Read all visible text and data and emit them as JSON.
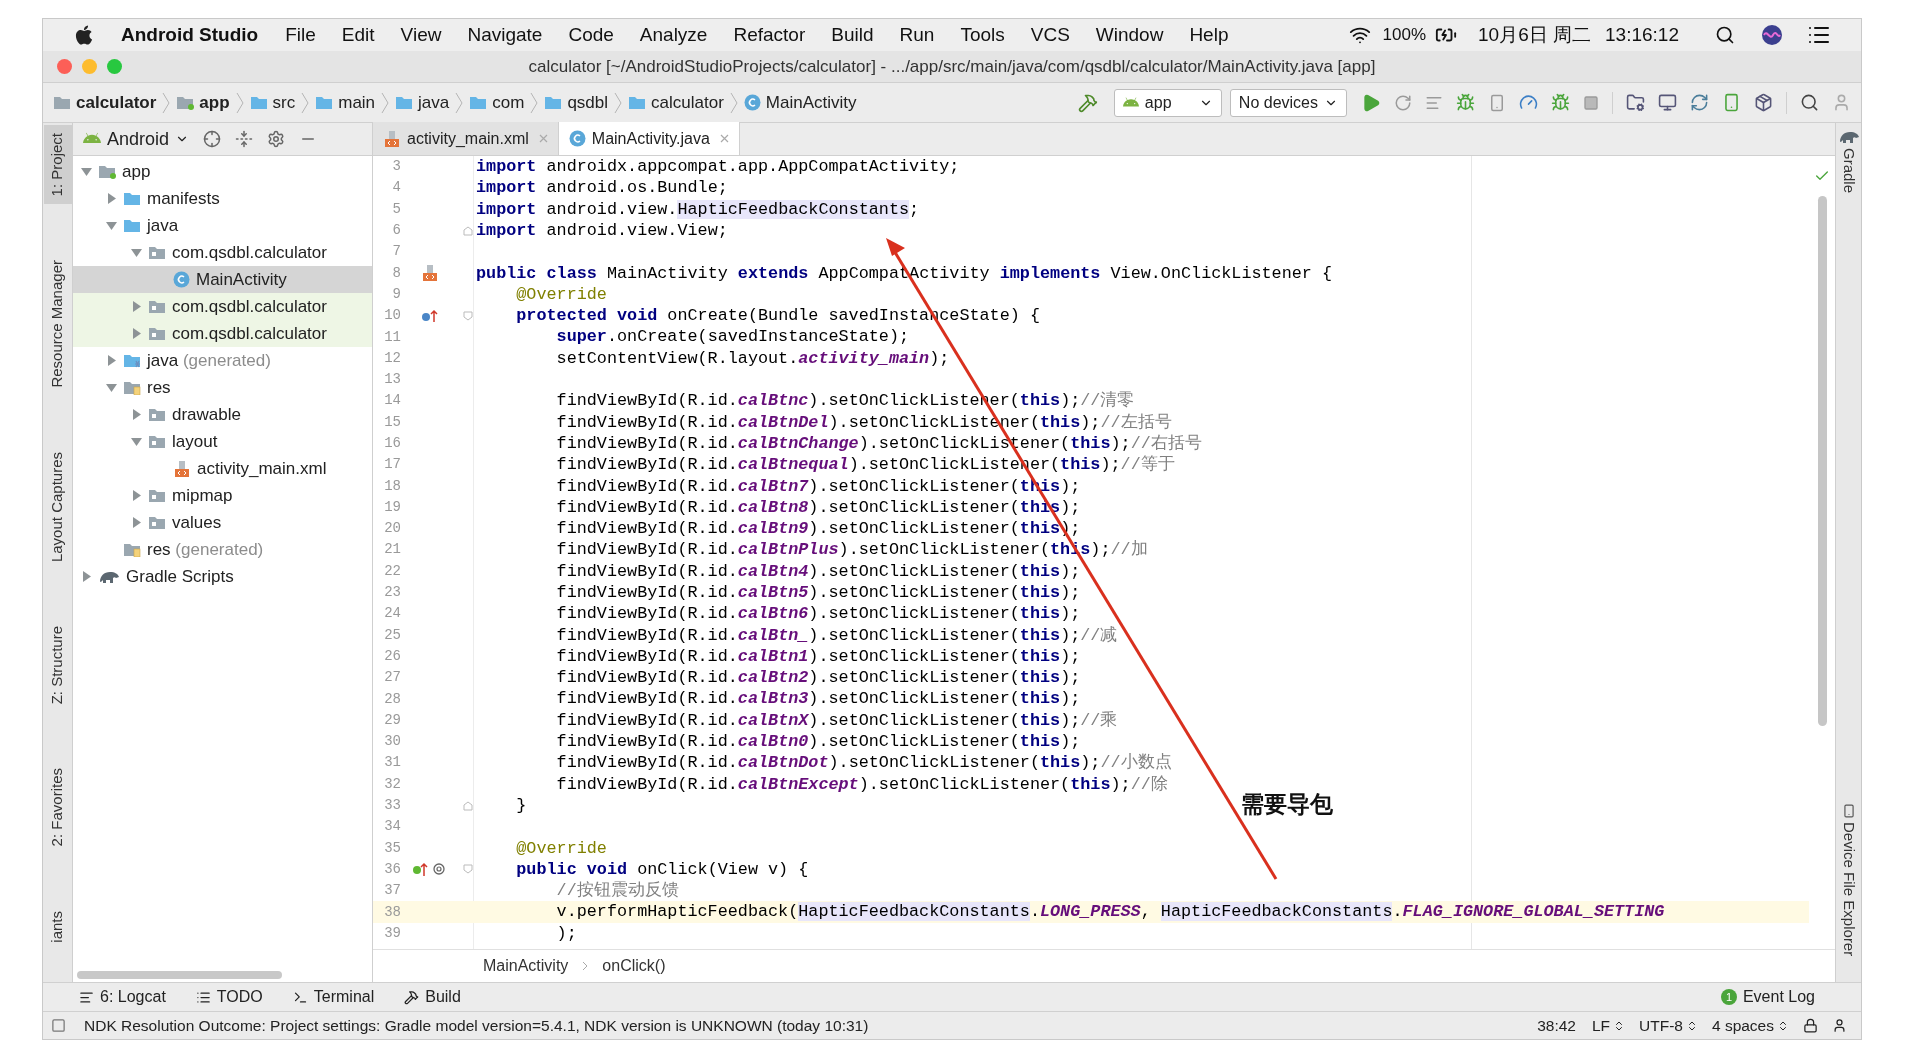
{
  "menu_bar": {
    "app_name": "Android Studio",
    "menus": [
      "File",
      "Edit",
      "View",
      "Navigate",
      "Code",
      "Analyze",
      "Refactor",
      "Build",
      "Run",
      "Tools",
      "VCS",
      "Window",
      "Help"
    ],
    "battery": "100%",
    "date": "10月6日 周二",
    "time": "13:16:12"
  },
  "window": {
    "title": "calculator [~/AndroidStudioProjects/calculator] - .../app/src/main/java/com/qsdbl/calculator/MainActivity.java [app]"
  },
  "navigation_bar": {
    "crumbs": [
      {
        "label": "calculator",
        "kind": "project"
      },
      {
        "label": "app",
        "kind": "module"
      },
      {
        "label": "src",
        "kind": "folder"
      },
      {
        "label": "main",
        "kind": "folder"
      },
      {
        "label": "java",
        "kind": "source"
      },
      {
        "label": "com",
        "kind": "folder"
      },
      {
        "label": "qsdbl",
        "kind": "folder"
      },
      {
        "label": "calculator",
        "kind": "folder"
      },
      {
        "label": "MainActivity",
        "kind": "class"
      }
    ],
    "run_configuration": "app",
    "device": "No devices"
  },
  "left_tool_strip": [
    {
      "label": "1: Project",
      "selected": true
    },
    {
      "label": "Resource Manager",
      "selected": false
    },
    {
      "label": "Layout Captures",
      "selected": false
    },
    {
      "label": "Z: Structure",
      "selected": false
    },
    {
      "label": "2: Favorites",
      "selected": false
    },
    {
      "label": "iants",
      "selected": false
    }
  ],
  "project_panel": {
    "view": "Android",
    "tree": [
      {
        "label": "app",
        "kind": "module",
        "expanded": true,
        "selected": false,
        "children": [
          {
            "label": "manifests",
            "kind": "folder",
            "expanded": false,
            "selected": false
          },
          {
            "label": "java",
            "kind": "folder",
            "expanded": true,
            "selected": false,
            "children": [
              {
                "label": "com.qsdbl.calculator",
                "kind": "package",
                "expanded": true,
                "selected": false,
                "children": [
                  {
                    "label": "MainActivity",
                    "kind": "class",
                    "selected": true
                  }
                ]
              },
              {
                "label": "com.qsdbl.calculator",
                "kind": "test-package",
                "expanded": false,
                "selected": false
              },
              {
                "label": "com.qsdbl.calculator",
                "kind": "test-package",
                "expanded": false,
                "selected": false
              }
            ]
          },
          {
            "label": "java",
            "note": "(generated)",
            "kind": "generated-folder",
            "expanded": false,
            "selected": false
          },
          {
            "label": "res",
            "kind": "res-folder",
            "expanded": true,
            "selected": false,
            "children": [
              {
                "label": "drawable",
                "kind": "package",
                "expanded": false,
                "selected": false
              },
              {
                "label": "layout",
                "kind": "package",
                "expanded": true,
                "selected": false,
                "children": [
                  {
                    "label": "activity_main.xml",
                    "kind": "xml",
                    "selected": false
                  }
                ]
              },
              {
                "label": "mipmap",
                "kind": "package",
                "expanded": false,
                "selected": false
              },
              {
                "label": "values",
                "kind": "package",
                "expanded": false,
                "selected": false
              }
            ]
          },
          {
            "label": "res",
            "note": "(generated)",
            "kind": "res-folder",
            "selected": false
          }
        ]
      },
      {
        "label": "Gradle Scripts",
        "kind": "gradle",
        "expanded": false,
        "selected": false
      }
    ]
  },
  "editor_tabs": [
    {
      "label": "activity_main.xml",
      "kind": "xml",
      "selected": false
    },
    {
      "label": "MainActivity.java",
      "kind": "class",
      "selected": true
    }
  ],
  "code_lines": [
    {
      "number": "3",
      "current": false,
      "segments": [
        {
          "kind": "kw",
          "text": "import"
        },
        {
          "kind": "text",
          "text": " androidx.appcompat.app.AppCompatActivity;"
        }
      ]
    },
    {
      "number": "4",
      "current": false,
      "segments": [
        {
          "kind": "kw",
          "text": "import"
        },
        {
          "kind": "text",
          "text": " android.os.Bundle;"
        }
      ]
    },
    {
      "number": "5",
      "current": false,
      "segments": [
        {
          "kind": "kw",
          "text": "import"
        },
        {
          "kind": "text",
          "text": " android.view."
        },
        {
          "kind": "ref",
          "text": "HapticFeedbackConstants"
        },
        {
          "kind": "text",
          "text": ";"
        }
      ]
    },
    {
      "number": "6",
      "current": false,
      "fold_end": true,
      "segments": [
        {
          "kind": "kw",
          "text": "import"
        },
        {
          "kind": "text",
          "text": " android.view.View;"
        }
      ]
    },
    {
      "number": "7",
      "current": false
    },
    {
      "number": "8",
      "current": false,
      "layout_link": true,
      "segments": [
        {
          "kind": "kw",
          "text": "public class"
        },
        {
          "kind": "text",
          "text": " MainActivity "
        },
        {
          "kind": "kw",
          "text": "extends"
        },
        {
          "kind": "text",
          "text": " AppCompatActivity "
        },
        {
          "kind": "kw",
          "text": "implements"
        },
        {
          "kind": "text",
          "text": " View.OnClickListener {"
        }
      ]
    },
    {
      "number": "9",
      "current": false,
      "segments": [
        {
          "kind": "annotation",
          "text": "    @Override"
        }
      ]
    },
    {
      "number": "10",
      "current": false,
      "overrides": true,
      "fold_start": true,
      "segments": [
        {
          "kind": "kw",
          "text": "    protected void"
        },
        {
          "kind": "text",
          "text": " onCreate(Bundle savedInstanceState) {"
        }
      ]
    },
    {
      "number": "11",
      "current": false,
      "segments": [
        {
          "kind": "kw",
          "text": "        super"
        },
        {
          "kind": "text",
          "text": ".onCreate(savedInstanceState);"
        }
      ]
    },
    {
      "number": "12",
      "current": false,
      "segments": [
        {
          "kind": "text",
          "text": "        setContentView(R.layout."
        },
        {
          "kind": "field",
          "text": "activity_main"
        },
        {
          "kind": "text",
          "text": ");"
        }
      ]
    },
    {
      "number": "13",
      "current": false
    },
    {
      "number": "14",
      "current": false,
      "segments": [
        {
          "kind": "text",
          "text": "        findViewById(R.id."
        },
        {
          "kind": "field",
          "text": "calBtnc"
        },
        {
          "kind": "text",
          "text": ").setOnClickListener("
        },
        {
          "kind": "kw",
          "text": "this"
        },
        {
          "kind": "text",
          "text": ");"
        },
        {
          "kind": "comment",
          "text": "//清零"
        }
      ]
    },
    {
      "number": "15",
      "current": false,
      "segments": [
        {
          "kind": "text",
          "text": "        findViewById(R.id."
        },
        {
          "kind": "field",
          "text": "calBtnDel"
        },
        {
          "kind": "text",
          "text": ").setOnClickListener("
        },
        {
          "kind": "kw",
          "text": "this"
        },
        {
          "kind": "text",
          "text": ");"
        },
        {
          "kind": "comment",
          "text": "//左括号"
        }
      ]
    },
    {
      "number": "16",
      "current": false,
      "segments": [
        {
          "kind": "text",
          "text": "        findViewById(R.id."
        },
        {
          "kind": "field",
          "text": "calBtnChange"
        },
        {
          "kind": "text",
          "text": ").setOnClickListener("
        },
        {
          "kind": "kw",
          "text": "this"
        },
        {
          "kind": "text",
          "text": ");"
        },
        {
          "kind": "comment",
          "text": "//右括号"
        }
      ]
    },
    {
      "number": "17",
      "current": false,
      "segments": [
        {
          "kind": "text",
          "text": "        findViewById(R.id."
        },
        {
          "kind": "field",
          "text": "calBtnequal"
        },
        {
          "kind": "text",
          "text": ").setOnClickListener("
        },
        {
          "kind": "kw",
          "text": "this"
        },
        {
          "kind": "text",
          "text": ");"
        },
        {
          "kind": "comment",
          "text": "//等于"
        }
      ]
    },
    {
      "number": "18",
      "current": false,
      "segments": [
        {
          "kind": "text",
          "text": "        findViewById(R.id."
        },
        {
          "kind": "field",
          "text": "calBtn7"
        },
        {
          "kind": "text",
          "text": ").setOnClickListener("
        },
        {
          "kind": "kw",
          "text": "this"
        },
        {
          "kind": "text",
          "text": ");"
        }
      ]
    },
    {
      "number": "19",
      "current": false,
      "segments": [
        {
          "kind": "text",
          "text": "        findViewById(R.id."
        },
        {
          "kind": "field",
          "text": "calBtn8"
        },
        {
          "kind": "text",
          "text": ").setOnClickListener("
        },
        {
          "kind": "kw",
          "text": "this"
        },
        {
          "kind": "text",
          "text": ");"
        }
      ]
    },
    {
      "number": "20",
      "current": false,
      "segments": [
        {
          "kind": "text",
          "text": "        findViewById(R.id."
        },
        {
          "kind": "field",
          "text": "calBtn9"
        },
        {
          "kind": "text",
          "text": ").setOnClickListener("
        },
        {
          "kind": "kw",
          "text": "this"
        },
        {
          "kind": "text",
          "text": ");"
        }
      ]
    },
    {
      "number": "21",
      "current": false,
      "segments": [
        {
          "kind": "text",
          "text": "        findViewById(R.id."
        },
        {
          "kind": "field",
          "text": "calBtnPlus"
        },
        {
          "kind": "text",
          "text": ").setOnClickListener("
        },
        {
          "kind": "kw",
          "text": "this"
        },
        {
          "kind": "text",
          "text": ");"
        },
        {
          "kind": "comment",
          "text": "//加"
        }
      ]
    },
    {
      "number": "22",
      "current": false,
      "segments": [
        {
          "kind": "text",
          "text": "        findViewById(R.id."
        },
        {
          "kind": "field",
          "text": "calBtn4"
        },
        {
          "kind": "text",
          "text": ").setOnClickListener("
        },
        {
          "kind": "kw",
          "text": "this"
        },
        {
          "kind": "text",
          "text": ");"
        }
      ]
    },
    {
      "number": "23",
      "current": false,
      "segments": [
        {
          "kind": "text",
          "text": "        findViewById(R.id."
        },
        {
          "kind": "field",
          "text": "calBtn5"
        },
        {
          "kind": "text",
          "text": ").setOnClickListener("
        },
        {
          "kind": "kw",
          "text": "this"
        },
        {
          "kind": "text",
          "text": ");"
        }
      ]
    },
    {
      "number": "24",
      "current": false,
      "segments": [
        {
          "kind": "text",
          "text": "        findViewById(R.id."
        },
        {
          "kind": "field",
          "text": "calBtn6"
        },
        {
          "kind": "text",
          "text": ").setOnClickListener("
        },
        {
          "kind": "kw",
          "text": "this"
        },
        {
          "kind": "text",
          "text": ");"
        }
      ]
    },
    {
      "number": "25",
      "current": false,
      "segments": [
        {
          "kind": "text",
          "text": "        findViewById(R.id."
        },
        {
          "kind": "field",
          "text": "calBtn_"
        },
        {
          "kind": "text",
          "text": ").setOnClickListener("
        },
        {
          "kind": "kw",
          "text": "this"
        },
        {
          "kind": "text",
          "text": ");"
        },
        {
          "kind": "comment",
          "text": "//减"
        }
      ]
    },
    {
      "number": "26",
      "current": false,
      "segments": [
        {
          "kind": "text",
          "text": "        findViewById(R.id."
        },
        {
          "kind": "field",
          "text": "calBtn1"
        },
        {
          "kind": "text",
          "text": ").setOnClickListener("
        },
        {
          "kind": "kw",
          "text": "this"
        },
        {
          "kind": "text",
          "text": ");"
        }
      ]
    },
    {
      "number": "27",
      "current": false,
      "segments": [
        {
          "kind": "text",
          "text": "        findViewById(R.id."
        },
        {
          "kind": "field",
          "text": "calBtn2"
        },
        {
          "kind": "text",
          "text": ").setOnClickListener("
        },
        {
          "kind": "kw",
          "text": "this"
        },
        {
          "kind": "text",
          "text": ");"
        }
      ]
    },
    {
      "number": "28",
      "current": false,
      "segments": [
        {
          "kind": "text",
          "text": "        findViewById(R.id."
        },
        {
          "kind": "field",
          "text": "calBtn3"
        },
        {
          "kind": "text",
          "text": ").setOnClickListener("
        },
        {
          "kind": "kw",
          "text": "this"
        },
        {
          "kind": "text",
          "text": ");"
        }
      ]
    },
    {
      "number": "29",
      "current": false,
      "segments": [
        {
          "kind": "text",
          "text": "        findViewById(R.id."
        },
        {
          "kind": "field",
          "text": "calBtnX"
        },
        {
          "kind": "text",
          "text": ").setOnClickListener("
        },
        {
          "kind": "kw",
          "text": "this"
        },
        {
          "kind": "text",
          "text": ");"
        },
        {
          "kind": "comment",
          "text": "//乘"
        }
      ]
    },
    {
      "number": "30",
      "current": false,
      "segments": [
        {
          "kind": "text",
          "text": "        findViewById(R.id."
        },
        {
          "kind": "field",
          "text": "calBtn0"
        },
        {
          "kind": "text",
          "text": ").setOnClickListener("
        },
        {
          "kind": "kw",
          "text": "this"
        },
        {
          "kind": "text",
          "text": ");"
        }
      ]
    },
    {
      "number": "31",
      "current": false,
      "segments": [
        {
          "kind": "text",
          "text": "        findViewById(R.id."
        },
        {
          "kind": "field",
          "text": "calBtnDot"
        },
        {
          "kind": "text",
          "text": ").setOnClickListener("
        },
        {
          "kind": "kw",
          "text": "this"
        },
        {
          "kind": "text",
          "text": ");"
        },
        {
          "kind": "comment",
          "text": "//小数点"
        }
      ]
    },
    {
      "number": "32",
      "current": false,
      "segments": [
        {
          "kind": "text",
          "text": "        findViewById(R.id."
        },
        {
          "kind": "field",
          "text": "calBtnExcept"
        },
        {
          "kind": "text",
          "text": ").setOnClickListener("
        },
        {
          "kind": "kw",
          "text": "this"
        },
        {
          "kind": "text",
          "text": ");"
        },
        {
          "kind": "comment",
          "text": "//除"
        }
      ]
    },
    {
      "number": "33",
      "current": false,
      "fold_end": true,
      "segments": [
        {
          "kind": "text",
          "text": "    }"
        }
      ]
    },
    {
      "number": "34",
      "current": false
    },
    {
      "number": "35",
      "current": false,
      "segments": [
        {
          "kind": "annotation",
          "text": "    @Override"
        }
      ]
    },
    {
      "number": "36",
      "current": false,
      "implements_marker": true,
      "fold_start": true,
      "segments": [
        {
          "kind": "kw",
          "text": "    public void"
        },
        {
          "kind": "text",
          "text": " onClick(View v) {"
        }
      ]
    },
    {
      "number": "37",
      "current": false,
      "segments": [
        {
          "kind": "comment",
          "text": "        //按钮震动反馈"
        }
      ]
    },
    {
      "number": "38",
      "current": true,
      "segments": [
        {
          "kind": "text",
          "text": "        v.performHapticFeedback("
        },
        {
          "kind": "ref",
          "text": "HapticFeedbackConstants"
        },
        {
          "kind": "text",
          "text": "."
        },
        {
          "kind": "static",
          "text": "LONG_PRESS"
        },
        {
          "kind": "text",
          "text": ", "
        },
        {
          "kind": "ref",
          "text": "HapticFeedbackConstants"
        },
        {
          "kind": "text",
          "text": "."
        },
        {
          "kind": "static",
          "text": "FLAG_IGNORE_GLOBAL_SETTING"
        }
      ]
    },
    {
      "number": "39",
      "current": false,
      "segments": [
        {
          "kind": "text",
          "text": "        );"
        }
      ]
    }
  ],
  "annotation": {
    "label": "需要导包"
  },
  "right_tool_strip": [
    "Gradle",
    "Device File Explorer"
  ],
  "breadcrumbs": [
    "MainActivity",
    "onClick()"
  ],
  "tool_window_bar": {
    "left": [
      {
        "label": "6: Logcat",
        "kind": "logcat"
      },
      {
        "label": "TODO",
        "kind": "todo"
      },
      {
        "label": "Terminal",
        "kind": "terminal"
      },
      {
        "label": "Build",
        "kind": "build"
      }
    ],
    "event_log": {
      "label": "Event Log",
      "count": "1"
    }
  },
  "status_bar": {
    "message": "NDK Resolution Outcome: Project settings: Gradle model version=5.4.1, NDK version is UNKNOWN (today 10:31)",
    "position": "38:42",
    "line_separator": "LF",
    "encoding": "UTF-8",
    "indent": "4 spaces"
  }
}
